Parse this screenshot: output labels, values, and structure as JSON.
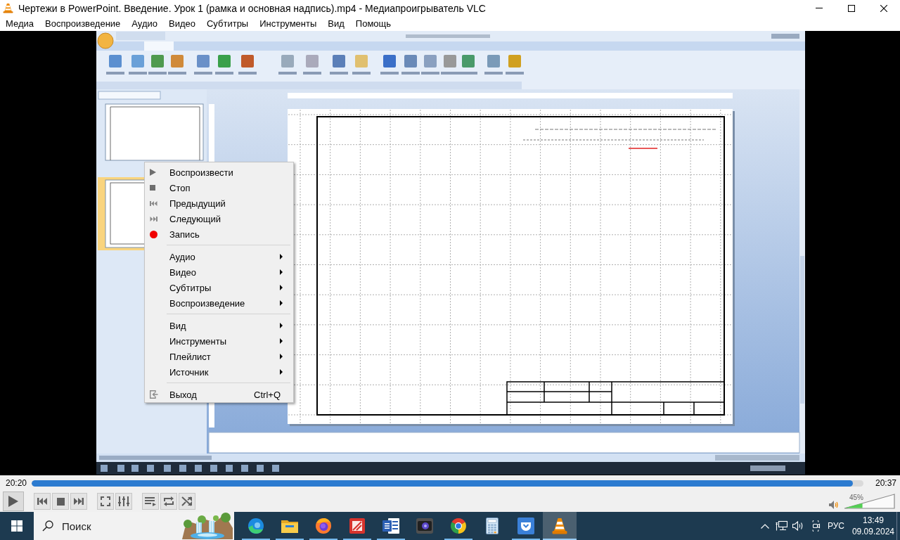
{
  "window": {
    "title": "Чертежи в PowerPoint. Введение. Урок 1 (рамка и основная надпись).mp4 - Медиапроигрыватель VLC"
  },
  "menu_bar": [
    "Медиа",
    "Воспроизведение",
    "Аудио",
    "Видео",
    "Субтитры",
    "Инструменты",
    "Вид",
    "Помощь"
  ],
  "context_menu": {
    "sections": [
      [
        {
          "label": "Воспроизвести",
          "kind": "command"
        },
        {
          "label": "Стоп",
          "kind": "command"
        },
        {
          "label": "Предыдущий",
          "kind": "command"
        },
        {
          "label": "Следующий",
          "kind": "command"
        },
        {
          "label": "Запись",
          "kind": "command"
        }
      ],
      [
        {
          "label": "Аудио",
          "kind": "submenu"
        },
        {
          "label": "Видео",
          "kind": "submenu"
        },
        {
          "label": "Субтитры",
          "kind": "submenu"
        },
        {
          "label": "Воспроизведение",
          "kind": "submenu"
        }
      ],
      [
        {
          "label": "Вид",
          "kind": "submenu"
        },
        {
          "label": "Инструменты",
          "kind": "submenu"
        },
        {
          "label": "Плейлист",
          "kind": "submenu"
        },
        {
          "label": "Источник",
          "kind": "submenu"
        }
      ],
      [
        {
          "label": "Выход",
          "kind": "command",
          "shortcut": "Ctrl+Q"
        }
      ]
    ]
  },
  "seek_bar": {
    "elapsed": "20:20",
    "total": "20:37",
    "level": 0.987
  },
  "volume": {
    "level": 0.36,
    "reading": "45%"
  },
  "taskbar": {
    "search": {
      "placeholder": "Поиск"
    },
    "apps": [
      {
        "running": true,
        "selected": false
      },
      {
        "running": true,
        "selected": false
      },
      {
        "running": true,
        "selected": false
      },
      {
        "running": true,
        "selected": false
      },
      {
        "running": true,
        "selected": false
      },
      {
        "running": false,
        "selected": false
      },
      {
        "running": true,
        "selected": false
      },
      {
        "running": false,
        "selected": false
      },
      {
        "running": true,
        "selected": false
      },
      {
        "running": true,
        "selected": true
      }
    ],
    "tray": {
      "language": "РУС",
      "time": "13:49",
      "date": "09.09.2024"
    }
  }
}
